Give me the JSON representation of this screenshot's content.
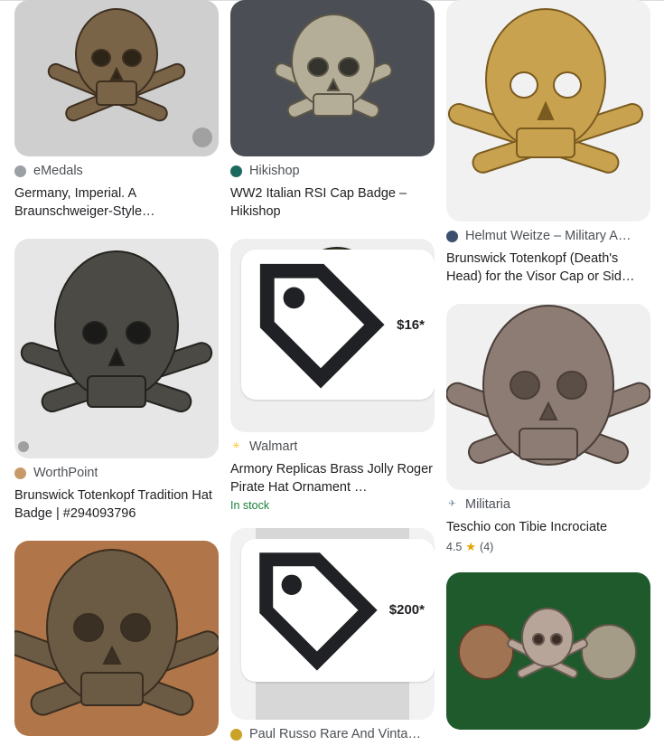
{
  "results": [
    {
      "source": "eMedals",
      "title": "Germany, Imperial. A Braunschweiger-Style…"
    },
    {
      "source": "WorthPoint",
      "title": "Brunswick Totenkopf Tradition Hat Badge | #294093796"
    },
    {
      "source": "Hikishop",
      "title": "WW2 Italian RSI Cap Badge – Hikishop"
    },
    {
      "source": "Walmart",
      "title": "Armory Replicas Brass Jolly Roger Pirate Hat Ornament …",
      "price": "$16*",
      "stock": "In stock"
    },
    {
      "price": "$200*",
      "source": "Paul Russo Rare And Vinta…"
    },
    {
      "source": "Helmut Weitze – Military A…",
      "title": "Brunswick Totenkopf (Death's Head) for the Visor Cap or Sid…"
    },
    {
      "source": "Militaria",
      "title": "Teschio con Tibie Incrociate",
      "rating": "4.5",
      "reviews": "(4)"
    }
  ],
  "colors": {
    "link_text": "#202124",
    "source_text": "#4d5156",
    "stock_green": "#188038",
    "star": "#e8a200"
  }
}
